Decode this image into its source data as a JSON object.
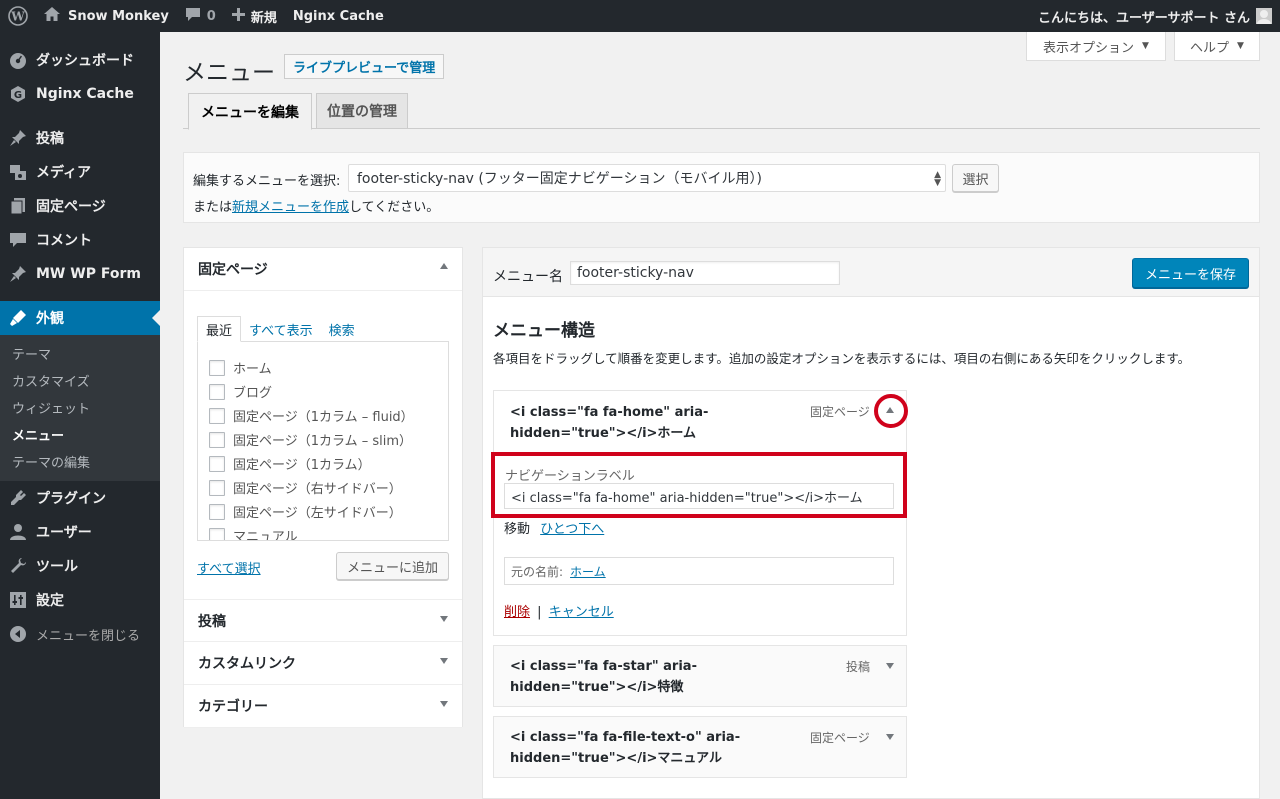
{
  "adminbar": {
    "site_name": "Snow Monkey",
    "comments_count": "0",
    "new_label": "新規",
    "plugin_link": "Nginx Cache",
    "greeting": "こんにちは、ユーザーサポート さん"
  },
  "sidebar": {
    "items": [
      {
        "label": "ダッシュボード",
        "icon": "dashboard-icon"
      },
      {
        "label": "Nginx Cache",
        "icon": "nginx-cache-icon"
      },
      {
        "label": "投稿",
        "icon": "pin-icon"
      },
      {
        "label": "メディア",
        "icon": "media-icon"
      },
      {
        "label": "固定ページ",
        "icon": "page-icon"
      },
      {
        "label": "コメント",
        "icon": "comment-icon"
      },
      {
        "label": "MW WP Form",
        "icon": "pin-icon"
      },
      {
        "label": "外観",
        "icon": "appearance-icon"
      },
      {
        "label": "プラグイン",
        "icon": "plugin-icon"
      },
      {
        "label": "ユーザー",
        "icon": "user-icon"
      },
      {
        "label": "ツール",
        "icon": "tool-icon"
      },
      {
        "label": "設定",
        "icon": "settings-icon"
      },
      {
        "label": "メニューを閉じる",
        "icon": "collapse-icon"
      }
    ],
    "submenu": [
      "テーマ",
      "カスタマイズ",
      "ウィジェット",
      "メニュー",
      "テーマの編集"
    ]
  },
  "screen_options": {
    "display_options": "表示オプション",
    "help": "ヘルプ"
  },
  "page": {
    "title": "メニュー",
    "live_preview": "ライブプレビューで管理",
    "tabs": [
      "メニューを編集",
      "位置の管理"
    ]
  },
  "manage": {
    "select_label": "編集するメニューを選択:",
    "selected_menu": "footer-sticky-nav (フッター固定ナビゲーション（モバイル用）)",
    "select_button": "選択",
    "or_text": "または",
    "create_link": "新規メニューを作成",
    "create_suffix": "してください。"
  },
  "left_panel": {
    "pages_title": "固定ページ",
    "list_tabs": [
      "最近",
      "すべて表示",
      "検索"
    ],
    "pages": [
      "ホーム",
      "ブログ",
      "固定ページ（1カラム – fluid）",
      "固定ページ（1カラム – slim）",
      "固定ページ（1カラム）",
      "固定ページ（右サイドバー）",
      "固定ページ（左サイドバー）",
      "マニュアル"
    ],
    "select_all": "すべて選択",
    "add_to_menu": "メニューに追加",
    "sections": [
      "投稿",
      "カスタムリンク",
      "カテゴリー"
    ]
  },
  "right_panel": {
    "menu_name_label": "メニュー名",
    "menu_name_value": "footer-sticky-nav",
    "save_button": "メニューを保存",
    "structure_title": "メニュー構造",
    "structure_desc": "各項目をドラッグして順番を変更します。追加の設定オプションを表示するには、項目の右側にある矢印をクリックします。",
    "items": [
      {
        "title_line1": "<i class=\"fa fa-home\" aria-",
        "title_line2": "hidden=\"true\"></i>ホーム",
        "type": "固定ページ"
      },
      {
        "title_line1": "<i class=\"fa fa-star\" aria-",
        "title_line2": "hidden=\"true\"></i>特徴",
        "type": "投稿"
      },
      {
        "title_line1": "<i class=\"fa fa-file-text-o\" aria-",
        "title_line2": "hidden=\"true\"></i>マニュアル",
        "type": "固定ページ"
      }
    ],
    "item_settings": {
      "nav_label_label": "ナビゲーションラベル",
      "nav_label_value": "<i class=\"fa fa-home\" aria-hidden=\"true\"></i>ホーム",
      "move_label": "移動",
      "move_link": "ひとつ下へ",
      "original_label": "元の名前:",
      "original_link": "ホーム",
      "delete": "削除",
      "separator": "|",
      "cancel": "キャンセル"
    }
  },
  "colors": {
    "adminbar_bg": "#23282d",
    "accent": "#0073aa",
    "primary_button": "#0085ba",
    "highlight_red": "#d0021b"
  }
}
